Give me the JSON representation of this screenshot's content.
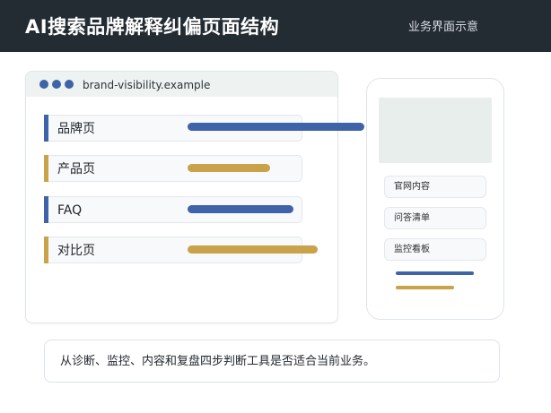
{
  "header": {
    "title": "AI搜索品牌解释纠偏页面结构",
    "subtitle": "业务界面示意"
  },
  "browser": {
    "url": "brand-visibility.example",
    "rows": [
      {
        "label": "品牌页",
        "color": "#3f63a8"
      },
      {
        "label": "产品页",
        "color": "#c9a24a"
      },
      {
        "label": "FAQ",
        "color": "#3f63a8"
      },
      {
        "label": "对比页",
        "color": "#c9a24a"
      }
    ]
  },
  "phone": {
    "buttons": [
      {
        "label": "官网内容"
      },
      {
        "label": "问答清单"
      },
      {
        "label": "监控看板"
      }
    ]
  },
  "caption": {
    "text": "从诊断、监控、内容和复盘四步判断工具是否适合当前业务。"
  },
  "colors": {
    "header_bg": "#232b33",
    "blue": "#3f63a8",
    "gold": "#c9a24a"
  }
}
